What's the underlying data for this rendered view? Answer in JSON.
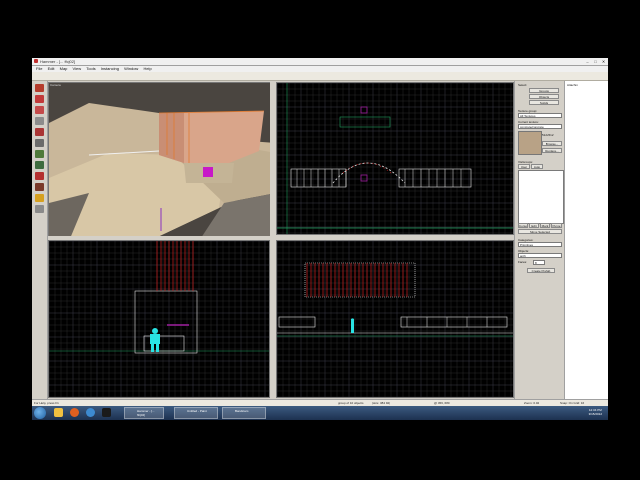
{
  "window": {
    "title": "Hammer - [... ffcj02]",
    "controls": [
      "–",
      "□",
      "✕"
    ]
  },
  "menu": [
    "File",
    "Edit",
    "Map",
    "View",
    "Tools",
    "Instancing",
    "Window",
    "Help"
  ],
  "viewports": {
    "camera_label": "Camera",
    "top_label": "",
    "front_label": "",
    "side_label": ""
  },
  "right_panel": {
    "select_label": "Select:",
    "mode_buttons": [
      "Groups",
      "Objects",
      "Solids"
    ],
    "texture_group_label": "Texture group:",
    "texture_group_value": "All Textures",
    "current_texture_label": "Current texture:",
    "current_texture_value": "concrete/concrete",
    "texture_size": "512x512",
    "browse_button": "Browse...",
    "replace_button": "Replace...",
    "visgroups_label": "VisGroups:",
    "visgroup_tabs": [
      "User",
      "Auto"
    ],
    "visgroup_buttons": [
      "Cursor",
      "Edit",
      "Mark",
      "Purge"
    ],
    "move_selected_button": "Move Selected",
    "categories_label": "Categories:",
    "categories_value": "Primitives",
    "objects_label": "Objects:",
    "objects_value": "arch",
    "faces_label": "Faces:",
    "faces_value": "8",
    "create_prefab_button": "Create Prefab"
  },
  "side_panel": {
    "title": "Attachm"
  },
  "status": {
    "help": "For Help, press F1",
    "selection": "group of 10 objects",
    "size": "(size: 384 92)",
    "coords": "@ 456, 680",
    "zoom": "Zoom: 0.02",
    "snap": "Snap: On Grid: 16"
  },
  "taskbar": {
    "tasks": [
      "Hammer - [... ffcj02]",
      "Untitled - Paint",
      "Bandicam"
    ],
    "time": "12:34 PM",
    "date": "3/15/2012"
  },
  "colors": {
    "grid": "#2a2a2a",
    "grid_major": "#3c3c4a",
    "brush_white": "#e8e8e8",
    "selection_red": "#d02020",
    "entity_cyan": "#29e3e3",
    "axis_green": "#20a060",
    "entity_magenta": "#a020a0"
  },
  "icons": {
    "tool_column": [
      "selection-icon",
      "magnify-icon",
      "camera-icon",
      "entity-icon",
      "block-icon",
      "texture-icon",
      "apply-texture-icon",
      "decal-icon",
      "overlay-icon",
      "clip-icon",
      "vertex-icon",
      "path-icon"
    ]
  }
}
